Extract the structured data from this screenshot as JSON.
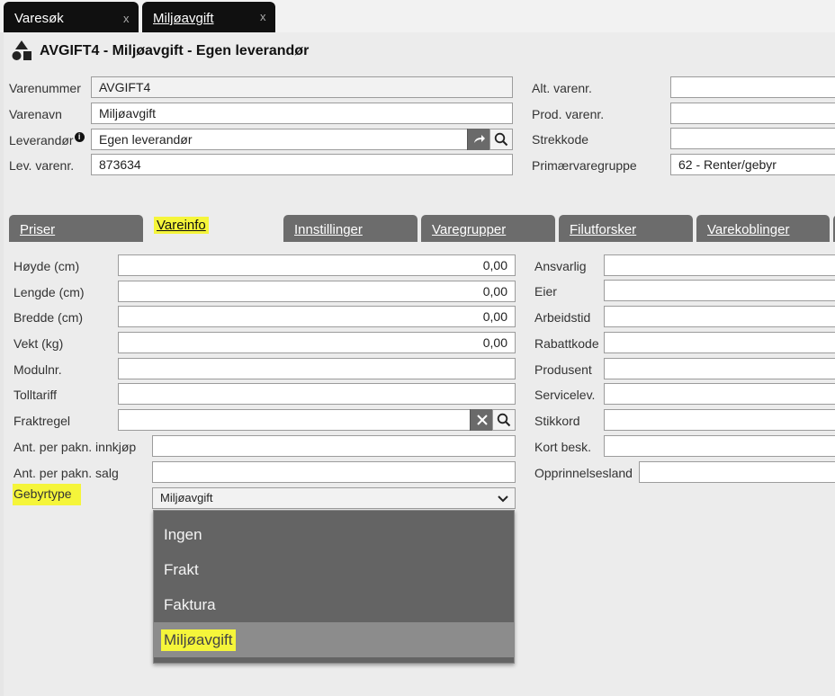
{
  "window_tabs": [
    {
      "label": "Varesøk",
      "close": "x"
    },
    {
      "label": "Miljøavgift",
      "close": "x"
    }
  ],
  "title": "AVGIFT4 - Miljøavgift - Egen leverandør",
  "header": {
    "varenummer": {
      "label": "Varenummer",
      "value": "AVGIFT4"
    },
    "varenavn": {
      "label": "Varenavn",
      "value": "Miljøavgift"
    },
    "leverandor": {
      "label": "Leverandør",
      "value": "Egen leverandør"
    },
    "lev_varenr": {
      "label": "Lev. varenr.",
      "value": "873634"
    },
    "alt_varenr": {
      "label": "Alt. varenr.",
      "value": ""
    },
    "prod_varenr": {
      "label": "Prod. varenr.",
      "value": ""
    },
    "strekkode": {
      "label": "Strekkode",
      "value": ""
    },
    "primaervaregruppe": {
      "label": "Primærvaregruppe",
      "value": "62 - Renter/gebyr"
    }
  },
  "section_tabs": [
    {
      "label": "Priser"
    },
    {
      "label": "Vareinfo"
    },
    {
      "label": "Innstillinger"
    },
    {
      "label": "Varegrupper"
    },
    {
      "label": "Filutforsker"
    },
    {
      "label": "Varekoblinger"
    }
  ],
  "vareinfo_left": {
    "hoyde": {
      "label": "Høyde (cm)",
      "value": "0,00"
    },
    "lengde": {
      "label": "Lengde (cm)",
      "value": "0,00"
    },
    "bredde": {
      "label": "Bredde (cm)",
      "value": "0,00"
    },
    "vekt": {
      "label": "Vekt (kg)",
      "value": "0,00"
    },
    "modulnr": {
      "label": "Modulnr.",
      "value": ""
    },
    "tolltariff": {
      "label": "Tolltariff",
      "value": ""
    },
    "fraktregel": {
      "label": "Fraktregel",
      "value": ""
    },
    "ant_innkjop": {
      "label": "Ant. per pakn. innkjøp",
      "value": ""
    },
    "ant_salg": {
      "label": "Ant. per pakn. salg",
      "value": ""
    },
    "gebyrtype": {
      "label": "Gebyrtype",
      "value": "Miljøavgift"
    }
  },
  "vareinfo_right": {
    "ansvarlig": {
      "label": "Ansvarlig",
      "value": ""
    },
    "eier": {
      "label": "Eier",
      "value": ""
    },
    "arbeidstid": {
      "label": "Arbeidstid",
      "value": ""
    },
    "rabattkode": {
      "label": "Rabattkode",
      "value": ""
    },
    "produsent": {
      "label": "Produsent",
      "value": ""
    },
    "servicelev": {
      "label": "Servicelev.",
      "value": ""
    },
    "stikkord": {
      "label": "Stikkord",
      "value": ""
    },
    "kort_besk": {
      "label": "Kort besk.",
      "value": ""
    },
    "opprinnelsesland": {
      "label": "Opprinnelsesland",
      "value": ""
    }
  },
  "gebyrtype_options": [
    "Ingen",
    "Frakt",
    "Faktura",
    "Miljøavgift"
  ],
  "colors": {
    "highlight": "#f5f53a",
    "tab_dark": "#6c6c6c",
    "window_tab": "#101010",
    "dropdown_bg": "#646464"
  }
}
